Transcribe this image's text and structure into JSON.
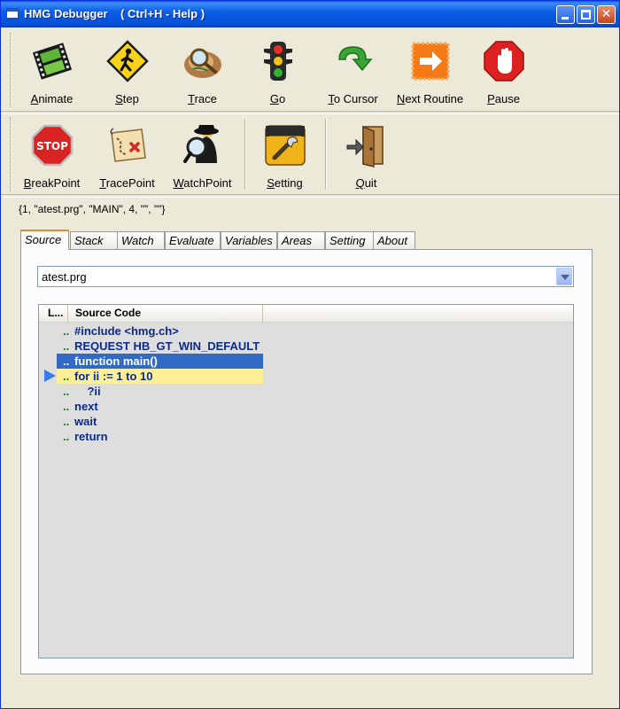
{
  "window": {
    "title": "HMG Debugger    ( Ctrl+H - Help )"
  },
  "toolbar1": [
    {
      "label": "Animate",
      "icon": "film-strip-icon"
    },
    {
      "label": "Step",
      "icon": "pedestrian-sign-icon"
    },
    {
      "label": "Trace",
      "icon": "magnifier-map-icon"
    },
    {
      "label": "Go",
      "icon": "traffic-light-icon"
    },
    {
      "label": "To Cursor",
      "icon": "green-arrow-icon"
    },
    {
      "label": "Next Routine",
      "icon": "next-routine-icon"
    },
    {
      "label": "Pause",
      "icon": "stop-hand-icon"
    }
  ],
  "toolbar2": [
    {
      "label": "BreakPoint",
      "icon": "stop-sign-icon"
    },
    {
      "label": "TracePoint",
      "icon": "treasure-map-icon"
    },
    {
      "label": "WatchPoint",
      "icon": "spy-magnifier-icon"
    },
    {
      "label": "Setting",
      "icon": "tools-icon"
    },
    {
      "label": "Quit",
      "icon": "exit-door-icon"
    }
  ],
  "status_line": "{1, \"atest.prg\", \"MAIN\", 4, \"\", \"\"}",
  "tabs": [
    "Source",
    "Stack",
    "Watch",
    "Evaluate",
    "Variables",
    "Areas",
    "Setting",
    "About"
  ],
  "active_tab": "Source",
  "source_file": "atest.prg",
  "grid": {
    "columns": [
      "L...",
      "Source Code"
    ],
    "rows": [
      {
        "line": "..",
        "code": "#include <hmg.ch>"
      },
      {
        "line": "..",
        "code": "REQUEST HB_GT_WIN_DEFAULT"
      },
      {
        "line": "..",
        "code": "function main()"
      },
      {
        "line": "..",
        "code": "for ii := 1 to 10"
      },
      {
        "line": "..",
        "code": "    ?ii"
      },
      {
        "line": "..",
        "code": "next"
      },
      {
        "line": "..",
        "code": "wait"
      },
      {
        "line": "..",
        "code": "return"
      }
    ],
    "selected_row": 3,
    "current_row": 4
  },
  "colors": {
    "title_bar": "#0b5ee6",
    "selection": "#316ac5",
    "current_line": "#fcef95",
    "tab_highlight": "#e68b2c"
  }
}
